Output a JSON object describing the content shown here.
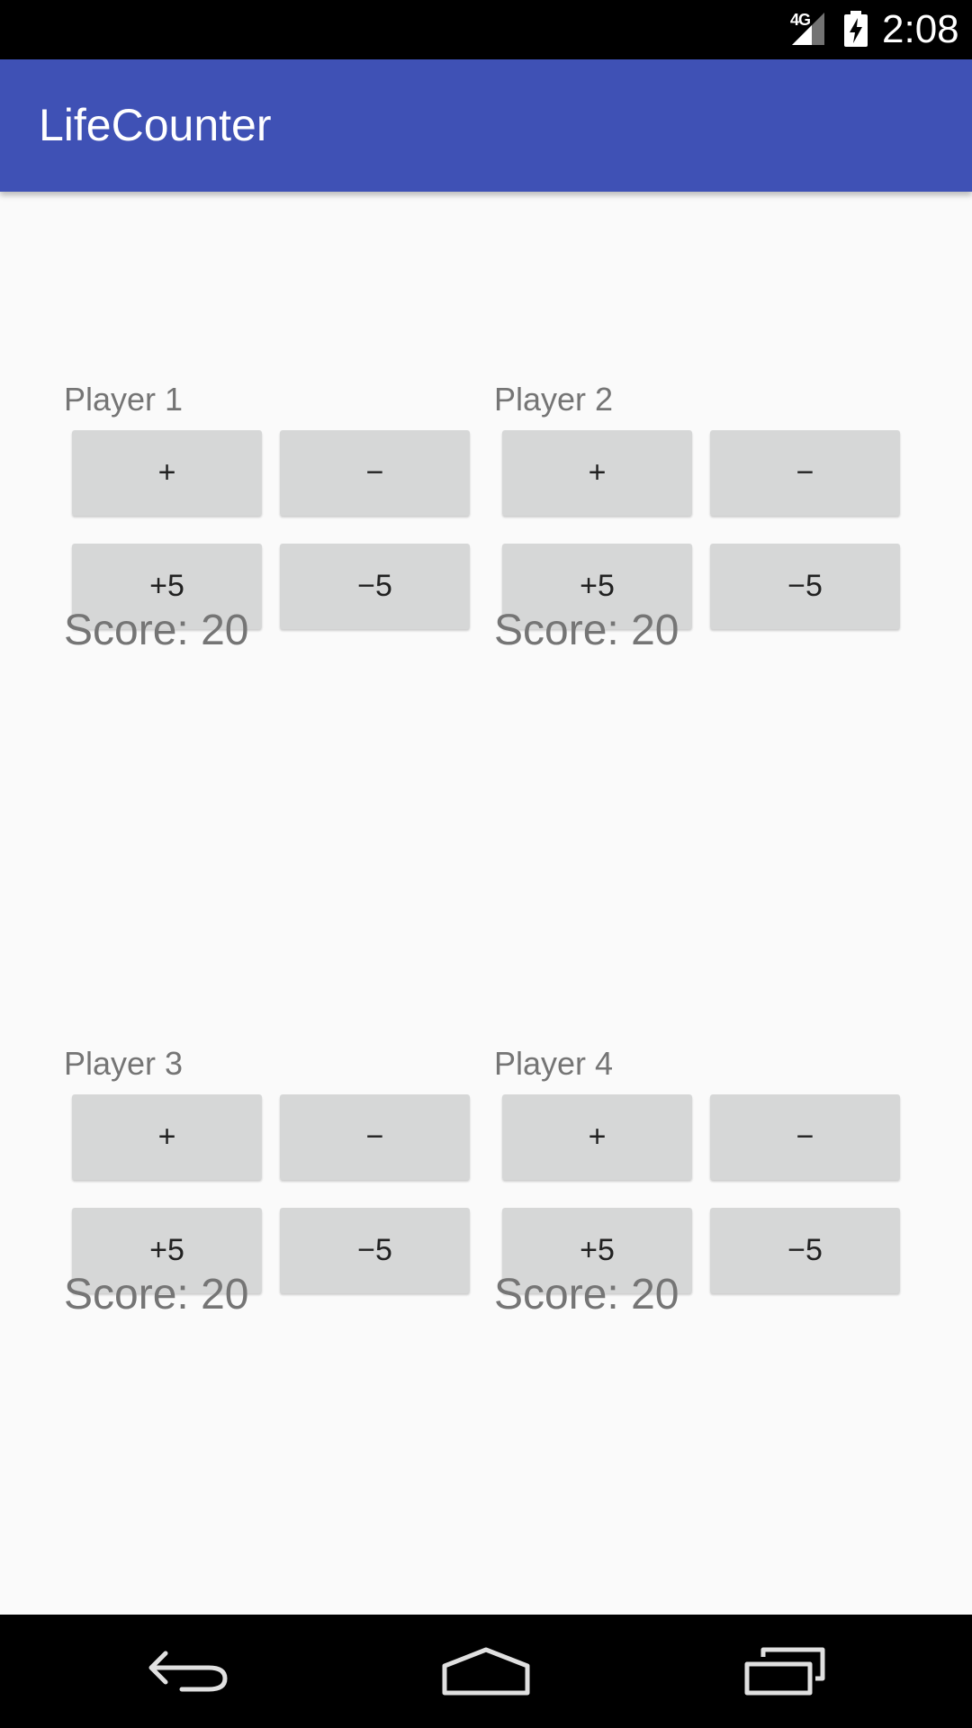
{
  "status_bar": {
    "network": "4G",
    "time": "2:08",
    "icons": [
      "signal-icon",
      "battery-charging-icon"
    ]
  },
  "app_bar": {
    "title": "LifeCounter",
    "color": "#3f51b5"
  },
  "players": [
    {
      "name": "Player 1",
      "buttons": {
        "plus": "+",
        "minus": "−",
        "plus5": "+5",
        "minus5": "−5"
      },
      "score_text": "Score: 20"
    },
    {
      "name": "Player 2",
      "buttons": {
        "plus": "+",
        "minus": "−",
        "plus5": "+5",
        "minus5": "−5"
      },
      "score_text": "Score: 20"
    },
    {
      "name": "Player 3",
      "buttons": {
        "plus": "+",
        "minus": "−",
        "plus5": "+5",
        "minus5": "−5"
      },
      "score_text": "Score: 20"
    },
    {
      "name": "Player 4",
      "buttons": {
        "plus": "+",
        "minus": "−",
        "plus5": "+5",
        "minus5": "−5"
      },
      "score_text": "Score: 20"
    }
  ],
  "nav_bar": {
    "icons": [
      "back-icon",
      "home-icon",
      "recent-apps-icon"
    ]
  },
  "colors": {
    "background": "#fafafa",
    "button": "#d6d7d7",
    "secondary_text": "#757575"
  }
}
